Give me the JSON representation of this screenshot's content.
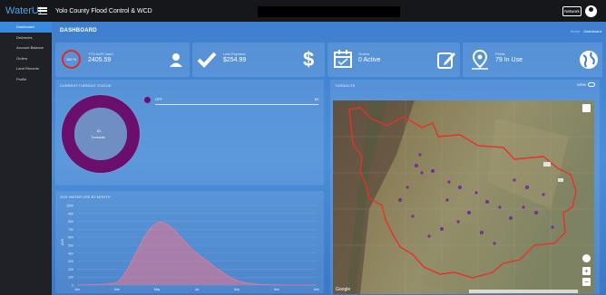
{
  "app": {
    "brand": "WaterUI",
    "org_title": "Yolo County Flood Control & WCD",
    "network_label": "Network"
  },
  "sidebar": {
    "items": [
      {
        "label": "Dashboard",
        "active": true
      },
      {
        "label": "Deliveries",
        "active": false
      },
      {
        "label": "Account Balance",
        "active": false
      },
      {
        "label": "Orders",
        "active": false
      },
      {
        "label": "Land Records",
        "active": false
      },
      {
        "label": "Profile",
        "active": false
      }
    ]
  },
  "header": {
    "title": "DASHBOARD",
    "breadcrumb_home": "Home",
    "breadcrumb_current": "Dashboard"
  },
  "cards": {
    "usage": {
      "badge": "100 %",
      "label": "YTD AcFt Used",
      "value": "2405.59",
      "icon": "user-icon"
    },
    "payment": {
      "label": "Last Payment",
      "value": "$254.99",
      "icon": "check-icon",
      "side_icon": "dollar-icon"
    },
    "orders": {
      "label": "Orders",
      "value": "0 Active",
      "icon": "calendar-icon",
      "side_icon": "edit-icon"
    },
    "fields": {
      "label": "Fields",
      "value": "79 In Use",
      "icon": "map-pin-icon",
      "side_icon": "globe-icon"
    }
  },
  "turnout_status": {
    "title": "CURRENT TURNOUT STATUS",
    "center_count": "81",
    "center_label": "Turnouts",
    "legend_label": "OFF",
    "legend_count": "81",
    "color": "#6a0f6e"
  },
  "water_use": {
    "title": "2021 WATER USE BY MONTH"
  },
  "turnouts": {
    "title": "TURNOUTS",
    "view_label": "VIEW",
    "map_credit": "Google"
  },
  "chart_data": {
    "type": "area",
    "title": "2021 WATER USE BY MONTH",
    "categories": [
      "Jan",
      "Mar",
      "May",
      "Jul",
      "Sep",
      "Nov",
      "Dec"
    ],
    "values": [
      0,
      30,
      780,
      400,
      60,
      0,
      0
    ],
    "yticks": [
      "1000",
      "900",
      "800",
      "700",
      "600",
      "500",
      "400",
      "300",
      "200",
      "100",
      "0"
    ],
    "ylim": [
      0,
      1000
    ],
    "ylabel": "AcFt",
    "grid": true
  }
}
